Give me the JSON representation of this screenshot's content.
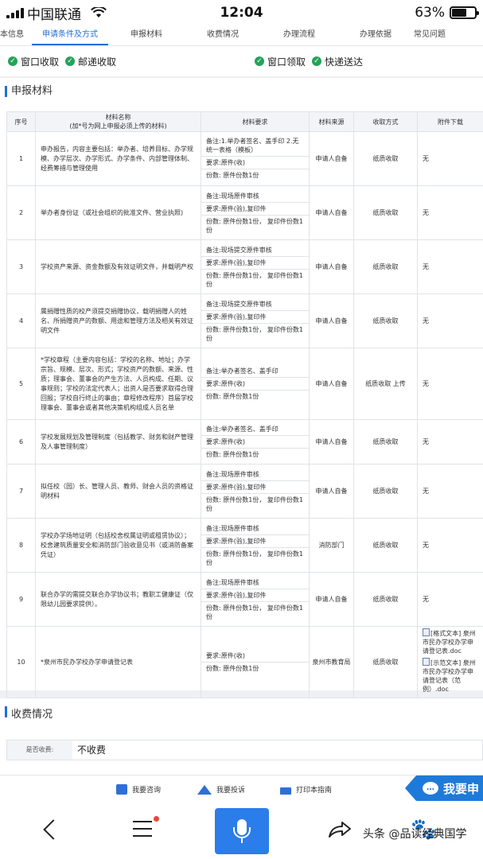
{
  "status": {
    "carrier": "中国联通",
    "time": "12:04",
    "battery": "63%",
    "battery_level": 0.63
  },
  "tabs": [
    "本信息",
    "申请条件及方式",
    "申报材料",
    "收费情况",
    "办理流程",
    "办理依据",
    "常见问题"
  ],
  "options": {
    "left": [
      "窗口收取",
      "邮递收取"
    ],
    "right": [
      "窗口领取",
      "快递送达"
    ]
  },
  "materials": {
    "title": "申报材料",
    "headers": {
      "no": "序号",
      "name": "材料名称\n(加*号为网上申报必须上传的材料)",
      "req": "材料要求",
      "source": "材料来源",
      "method": "收取方式",
      "attachment": "附件下载"
    },
    "rows": [
      {
        "no": "1",
        "name": "申办报告，内容主要包括：举办者、培养目标、办学规模、办学层次、办学形式、办学条件、内部管理体制、经费筹措与管理使用",
        "req": [
          "备注:1.举办者签名、盖手印 2.无统一表格（模板）",
          "要求:原件(收)",
          "份数: 原件份数1份"
        ],
        "source": "申请人自备",
        "method": "纸质收取",
        "attachment": "无"
      },
      {
        "no": "2",
        "name": "举办者身份证（或社会组织的批准文件、营业执照)",
        "req": [
          "备注:现场原件审核",
          "要求:原件(验),复印件",
          "份数: 原件份数1份， 复印件份数1份"
        ],
        "source": "申请人自备",
        "method": "纸质收取",
        "attachment": "无"
      },
      {
        "no": "3",
        "name": "学校资产来源、资金数额及有效证明文件，并载明产权",
        "req": [
          "备注:现场提交原件审核",
          "要求:原件(验),复印件",
          "份数: 原件份数1份， 复印件份数1份"
        ],
        "source": "申请人自备",
        "method": "纸质收取",
        "attachment": "无"
      },
      {
        "no": "4",
        "name": "属捐赠性质的校产须提交捐赠协议，载明捐赠人的姓名、所捐赠资产的数额、用途和管理方法及相关有效证明文件",
        "req": [
          "备注:现场提交原件审核",
          "要求:原件(验),复印件",
          "份数: 原件份数1份， 复印件份数1份"
        ],
        "source": "申请人自备",
        "method": "纸质收取",
        "attachment": "无"
      },
      {
        "no": "5",
        "name": "*学校章程（主要内容包括：学校的名称、地址；办学宗旨、规模、层次、形式；学校资产的数额、来源、性质；理事会、董事会的产生方法、人员构成、任期、议事规则；学校的法定代表人；出资人是否要求取得合理回报；学校自行终止的事由；章程修改程序）首届学校理事会、董事会或者其他决策机构组成人员名单",
        "req": [
          "备注:举办者签名、盖手印",
          "要求:原件(收)",
          "份数: 原件份数1份"
        ],
        "source": "申请人自备",
        "method": "纸质收取 上传",
        "attachment": "无"
      },
      {
        "no": "6",
        "name": "学校发展规划及管理制度（包括教学、财务和财产管理及人事管理制度）",
        "req": [
          "备注:举办者签名、盖手印",
          "要求:原件(收)",
          "份数: 原件份数1份"
        ],
        "source": "申请人自备",
        "method": "纸质收取",
        "attachment": "无"
      },
      {
        "no": "7",
        "name": "拟任校（园）长、管理人员、教师、财会人员的资格证明材料",
        "req": [
          "备注:现场原件审核",
          "要求:原件(验),复印件",
          "份数: 原件份数1份， 复印件份数1份"
        ],
        "source": "申请人自备",
        "method": "纸质收取",
        "attachment": "无"
      },
      {
        "no": "8",
        "name": "学校办学场地证明（包括校舍权属证明或租赁协议）；校舍建筑质量安全和消防部门验收意见书（或消防备案凭证）",
        "req": [
          "备注:现场原件审核",
          "要求:原件(验),复印件",
          "份数: 原件份数1份， 复印件份数1份"
        ],
        "source": "消防部门",
        "method": "纸质收取",
        "attachment": "无"
      },
      {
        "no": "9",
        "name": "联合办学的需提交联合办学协议书；教职工健康证（仅限幼儿园要求提供）。",
        "req": [
          "备注:现场原件审核",
          "要求:原件(验),复印件",
          "份数: 原件份数1份， 复印件份数1份"
        ],
        "source": "申请人自备",
        "method": "纸质收取",
        "attachment": "无"
      },
      {
        "no": "10",
        "name": "*泉州市民办学校办学申请登记表",
        "req": [
          "要求:原件(收)",
          "份数: 原件份数1份"
        ],
        "source": "泉州市教育局",
        "method": "纸质收取",
        "attachment_files": [
          "[格式文本] 泉州市民办学校办学申请登记表.doc",
          "[示范文本] 泉州市民办学校办学申请登记表（范例）.doc"
        ]
      }
    ]
  },
  "fees": {
    "title": "收费情况",
    "label": "是否收费:",
    "value": "不收费"
  },
  "actions": {
    "consult": "我要咨询",
    "complain": "我要投诉",
    "print": "打印本指南",
    "cta": "我要申"
  },
  "watermark": "头条 @品读经典国学"
}
